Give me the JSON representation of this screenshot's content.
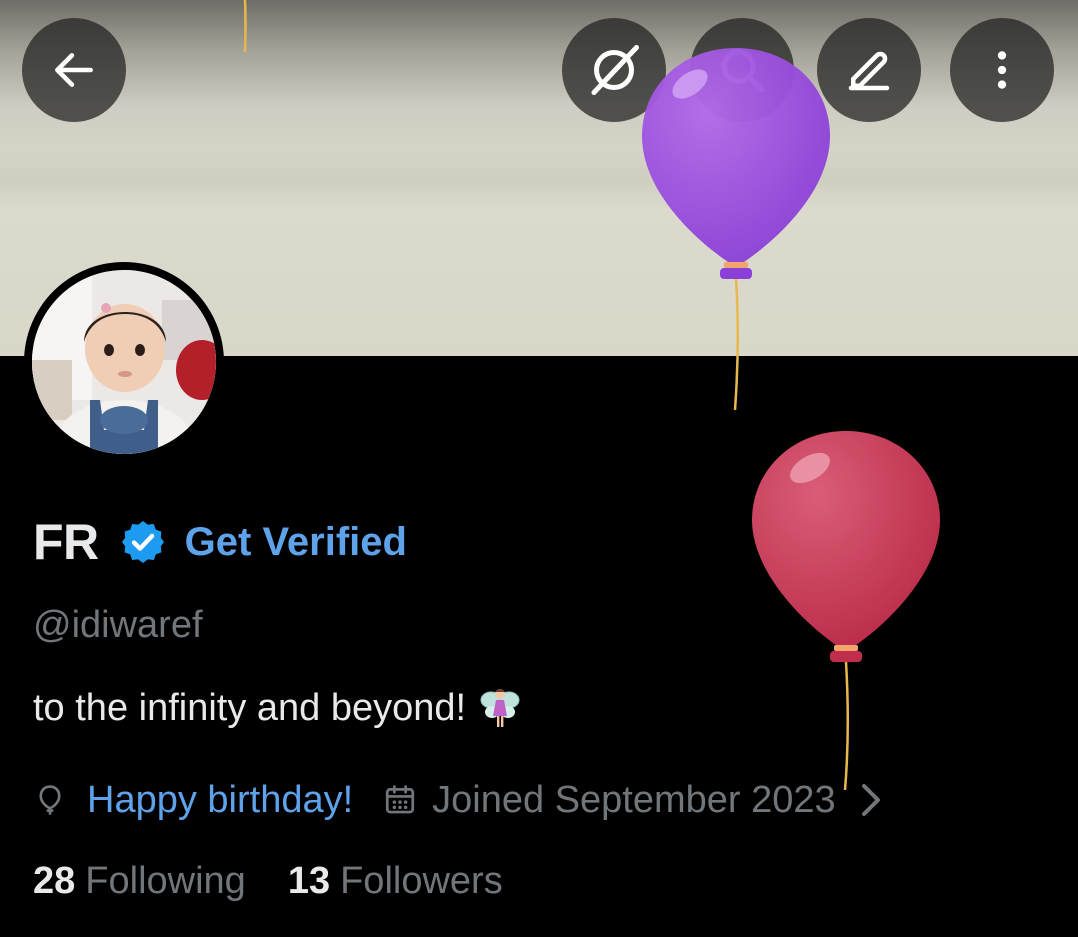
{
  "banner": {
    "description_colors": {
      "top": "#6e6c66",
      "bottom": "#d9d7c8"
    }
  },
  "toolbar": {
    "back_icon": "arrow-left-icon",
    "grok_icon": "grok-icon",
    "search_icon": "search-icon",
    "edit_icon": "edit-pencil-icon",
    "more_icon": "more-vertical-icon"
  },
  "profile": {
    "display_name": "FR",
    "get_verified": "Get Verified",
    "handle": "@idiwaref",
    "bio": "to the infinity and beyond!",
    "bio_emoji": "fairy-icon",
    "birthday": "Happy birthday!",
    "joined": "Joined September 2023",
    "following_count": "28",
    "following_label": "Following",
    "followers_count": "13",
    "followers_label": "Followers"
  },
  "colors": {
    "accent": "#5ea2ea",
    "badge": "#1d9bf0",
    "muted": "#71767b",
    "text": "#e7e9ea",
    "background": "#000000",
    "balloon_purple": "#9b4fe0",
    "balloon_red": "#d4405e"
  }
}
